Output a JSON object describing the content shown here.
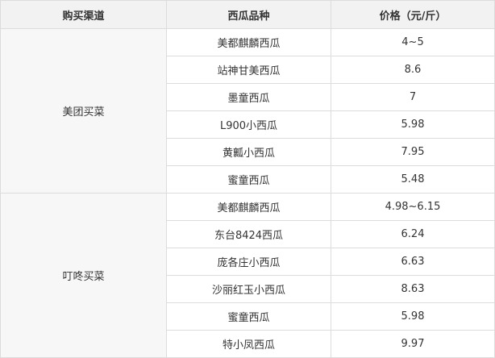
{
  "headers": [
    "购买渠道",
    "西瓜品种",
    "价格（元/斤）"
  ],
  "groups": [
    {
      "channel": "美团买菜",
      "rows": [
        {
          "variety": "美都麒麟西瓜",
          "price": "4~5"
        },
        {
          "variety": "站神甘美西瓜",
          "price": "8.6"
        },
        {
          "variety": "墨童西瓜",
          "price": "7"
        },
        {
          "variety": "L900小西瓜",
          "price": "5.98"
        },
        {
          "variety": "黄瓤小西瓜",
          "price": "7.95"
        },
        {
          "variety": "蜜童西瓜",
          "price": "5.48"
        }
      ]
    },
    {
      "channel": "叮咚买菜",
      "rows": [
        {
          "variety": "美都麒麟西瓜",
          "price": "4.98~6.15"
        },
        {
          "variety": "东台8424西瓜",
          "price": "6.24"
        },
        {
          "variety": "庞各庄小西瓜",
          "price": "6.63"
        },
        {
          "variety": "沙丽红玉小西瓜",
          "price": "8.63"
        },
        {
          "variety": "蜜童西瓜",
          "price": "5.98"
        },
        {
          "variety": "特小凤西瓜",
          "price": "9.97"
        }
      ]
    }
  ]
}
